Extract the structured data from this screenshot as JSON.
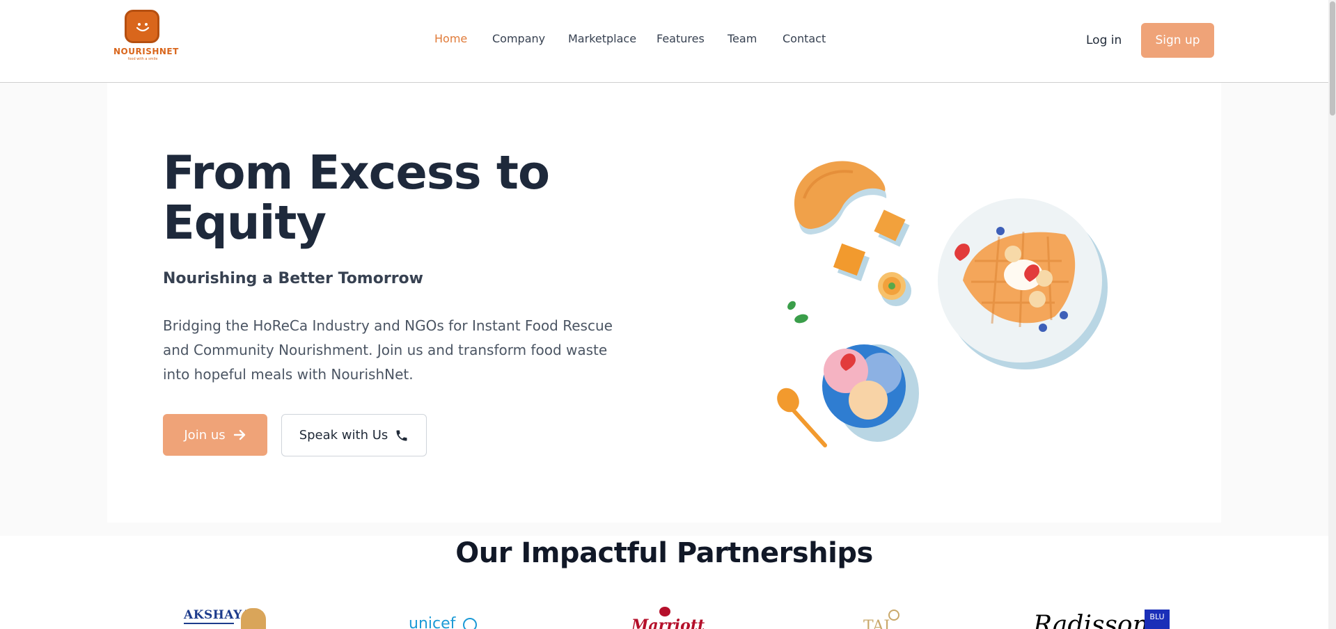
{
  "brand": {
    "name": "NOURISHNET",
    "tagline": "food with a smile"
  },
  "nav": {
    "items": [
      {
        "label": "Home",
        "active": true
      },
      {
        "label": "Company",
        "active": false
      },
      {
        "label": "Marketplace",
        "active": false
      },
      {
        "label": "Features",
        "active": false
      },
      {
        "label": "Team",
        "active": false
      },
      {
        "label": "Contact",
        "active": false
      }
    ],
    "login_label": "Log in",
    "signup_label": "Sign up"
  },
  "hero": {
    "title_line1": "From Excess to",
    "title_line2": "Equity",
    "subtitle": "Nourishing a Better Tomorrow",
    "description": "Bridging the HoReCa Industry and NGOs for Instant Food Rescue and Community Nourishment. Join us and transform food waste into hopeful meals with NourishNet.",
    "join_label": "Join us",
    "join_icon": "arrow-right-icon",
    "speak_label": "Speak with Us",
    "speak_icon": "phone-icon"
  },
  "partnerships": {
    "title": "Our Impactful Partnerships",
    "partners": [
      {
        "name": "Akshaya Patra",
        "logo_text": "AKSHAYA"
      },
      {
        "name": "UNICEF",
        "logo_text": "unicef"
      },
      {
        "name": "Marriott",
        "logo_text": "Marriott"
      },
      {
        "name": "Taj",
        "logo_text": "TAJ"
      },
      {
        "name": "Radisson Blu",
        "logo_text": "Radisson",
        "badge": "BLU"
      }
    ]
  },
  "colors": {
    "accent": "#efa378",
    "active_nav": "#e07b39",
    "brand_orange": "#d9661c",
    "heading": "#1e293b"
  }
}
